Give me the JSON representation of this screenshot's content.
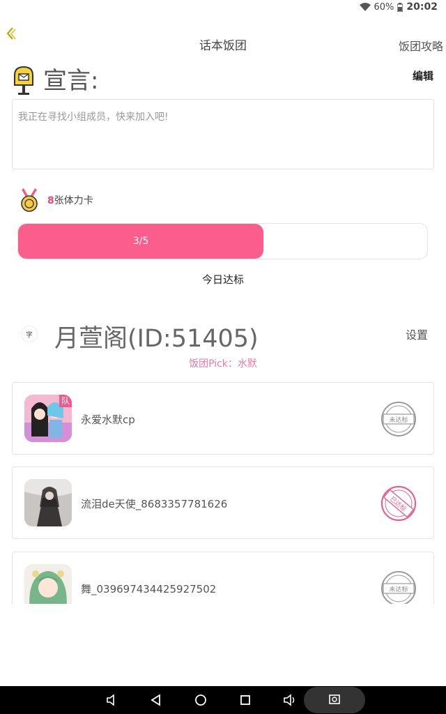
{
  "status": {
    "battery": "60%",
    "time": "20:02"
  },
  "nav": {
    "title": "话本饭团",
    "guide_label": "饭团攻略"
  },
  "declaration": {
    "title": "宣言:",
    "edit_label": "编辑",
    "text": "我正在寻找小组成员，快来加入吧!"
  },
  "stamina": {
    "count": "8",
    "suffix": "张体力卡"
  },
  "progress": {
    "label": "3/5",
    "value": 3,
    "max": 5,
    "caption": "今日达标"
  },
  "team": {
    "avatar_text": "字",
    "name": "月萱阁(ID:51405)",
    "settings_label": "设置",
    "pick": "饭团Pick：水默"
  },
  "members": [
    {
      "name": "永爱水默cp",
      "badge": "队",
      "status": "未达标",
      "achieved": false
    },
    {
      "name": "流泪de天使_8683357781626",
      "status": "已达标",
      "achieved": true
    },
    {
      "name": "舞_039697434425927502",
      "status": "未达标",
      "achieved": false
    }
  ],
  "colors": {
    "accent": "#fb5d8c",
    "pick": "#e87aa6",
    "achieved_stamp": "#e8608f",
    "pending_stamp": "#9a9a9a"
  }
}
